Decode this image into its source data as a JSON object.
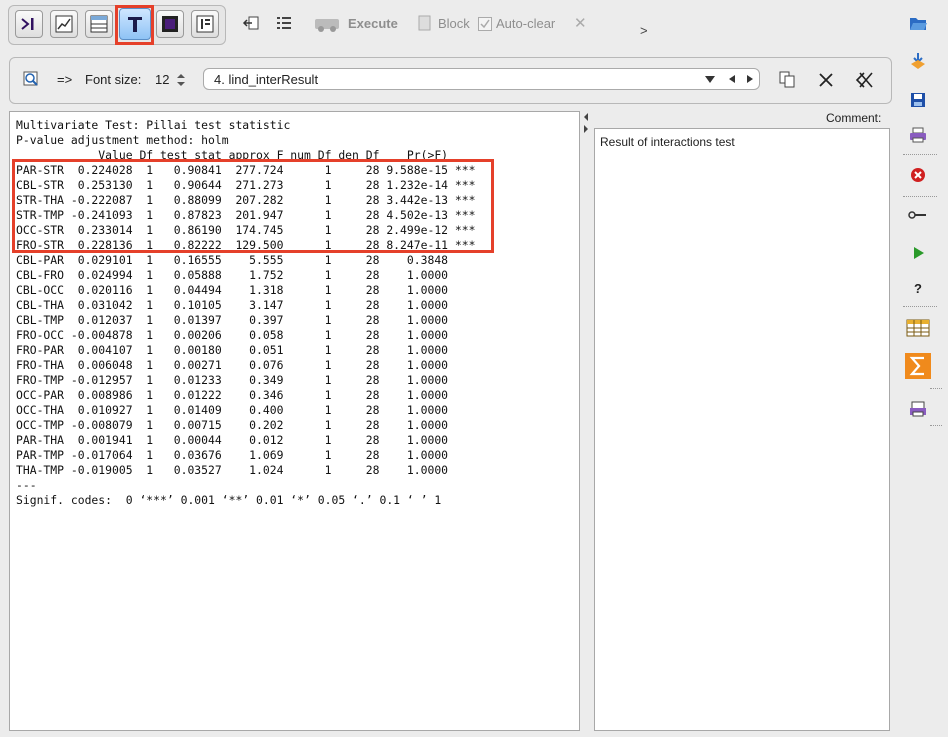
{
  "toolbar": {
    "execute_label": "Execute",
    "block_label": "Block",
    "autoclear_label": "Auto-clear",
    "close_symbol": "✕",
    "more_symbol": ">",
    "mode_buttons": [
      "console-mode-icon",
      "chart-mode-icon",
      "table-mode-icon",
      "text-mode-icon",
      "graphics-mode-icon",
      "results-mode-icon"
    ],
    "active_mode": "text-mode-icon"
  },
  "result_bar": {
    "arrow_label": "=>",
    "font_size_label": "Font size:",
    "font_size_value": "12",
    "selected_result": "4. lind_interResult"
  },
  "comment": {
    "label": "Comment:",
    "text": "Result of interactions test"
  },
  "output": {
    "lines": [
      "Multivariate Test: Pillai test statistic",
      "P-value adjustment method: holm",
      "            Value Df test stat approx F num Df den Df    Pr(>F)    ",
      "PAR-STR  0.224028  1   0.90841  277.724      1     28 9.588e-15 ***",
      "CBL-STR  0.253130  1   0.90644  271.273      1     28 1.232e-14 ***",
      "STR-THA -0.222087  1   0.88099  207.282      1     28 3.442e-13 ***",
      "STR-TMP -0.241093  1   0.87823  201.947      1     28 4.502e-13 ***",
      "OCC-STR  0.233014  1   0.86190  174.745      1     28 2.499e-12 ***",
      "FRO-STR  0.228136  1   0.82222  129.500      1     28 8.247e-11 ***",
      "CBL-PAR  0.029101  1   0.16555    5.555      1     28    0.3848    ",
      "CBL-FRO  0.024994  1   0.05888    1.752      1     28    1.0000    ",
      "CBL-OCC  0.020116  1   0.04494    1.318      1     28    1.0000    ",
      "CBL-THA  0.031042  1   0.10105    3.147      1     28    1.0000    ",
      "CBL-TMP  0.012037  1   0.01397    0.397      1     28    1.0000    ",
      "FRO-OCC -0.004878  1   0.00206    0.058      1     28    1.0000    ",
      "FRO-PAR  0.004107  1   0.00180    0.051      1     28    1.0000    ",
      "FRO-THA  0.006048  1   0.00271    0.076      1     28    1.0000    ",
      "FRO-TMP -0.012957  1   0.01233    0.349      1     28    1.0000    ",
      "OCC-PAR  0.008986  1   0.01222    0.346      1     28    1.0000    ",
      "OCC-THA  0.010927  1   0.01409    0.400      1     28    1.0000    ",
      "OCC-TMP -0.008079  1   0.00715    0.202      1     28    1.0000    ",
      "PAR-THA  0.001941  1   0.00044    0.012      1     28    1.0000    ",
      "PAR-TMP -0.017064  1   0.03676    1.069      1     28    1.0000    ",
      "THA-TMP -0.019005  1   0.03527    1.024      1     28    1.0000    ",
      "---",
      "Signif. codes:  0 ‘***’ 0.001 ‘**’ 0.01 ‘*’ 0.05 ‘.’ 0.1 ‘ ’ 1"
    ]
  },
  "colors": {
    "highlight": "#e5402a",
    "active_mode_bg": "#8fc3f5"
  }
}
